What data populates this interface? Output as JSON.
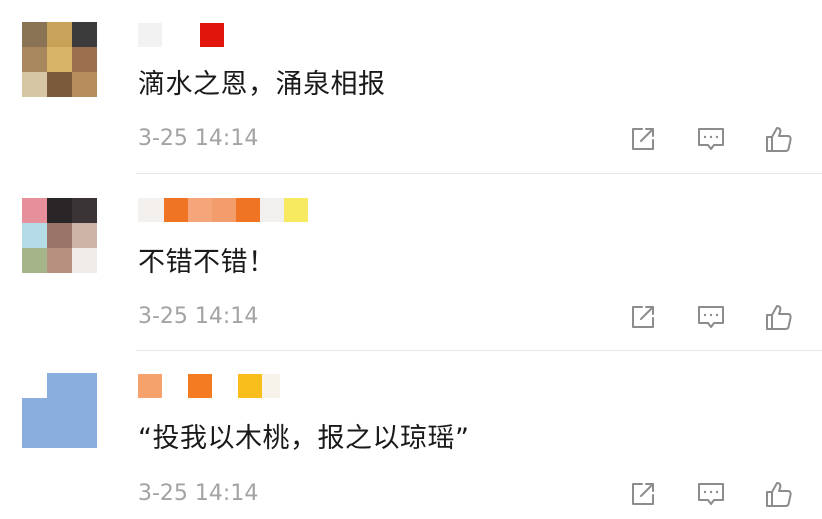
{
  "comments": [
    {
      "text": "滴水之恩，涌泉相报",
      "timestamp": "3-25 14:14",
      "avatar_colors": [
        "#8a7355",
        "#c9a25a",
        "#3b3b3b",
        "#a8865e",
        "#d8b468",
        "#9c6f4f",
        "#d6c6a4",
        "#7a5a3a",
        "#b88d5e"
      ],
      "name_mosaic_colors": [
        "#f2f2f2",
        "#e2150c"
      ]
    },
    {
      "text": "不错不错！",
      "timestamp": "3-25 14:14",
      "avatar_colors": [
        "#e6909c",
        "#2a2628",
        "#3a3436",
        "#b4dbe6",
        "#9a7468",
        "#ccb3a6",
        "#a6b48a",
        "#b89080",
        "#f0ece8"
      ],
      "name_mosaic_colors": [
        "#f4f0ee",
        "#ef7424",
        "#f6a57a",
        "#f39c6c",
        "#ef7424",
        "#f2f0ee",
        "#f8ea60"
      ]
    },
    {
      "text": "“投我以木桃，报之以琼瑶”",
      "timestamp": "3-25 14:14",
      "avatar_colors": [
        "#ffffff",
        "#8aaedd",
        "#8aaedd",
        "#8aaedd",
        "#8aaedd",
        "#8aaedd",
        "#8aaedd",
        "#8aaedd",
        "#8aaedd"
      ],
      "name_mosaic_colors": [
        "#f5a26c",
        "#ffffff",
        "#f47b22",
        "#ffffff",
        "#f9bd1c",
        "#f7f3ea"
      ]
    }
  ],
  "icons": {
    "share": "share-icon",
    "reply": "comment-icon",
    "like": "thumbs-up-icon"
  },
  "colors": {
    "text": "#1a1a1a",
    "meta": "#a3a3a3",
    "icon": "#8c8c8c",
    "divider": "#e6e6e6"
  }
}
